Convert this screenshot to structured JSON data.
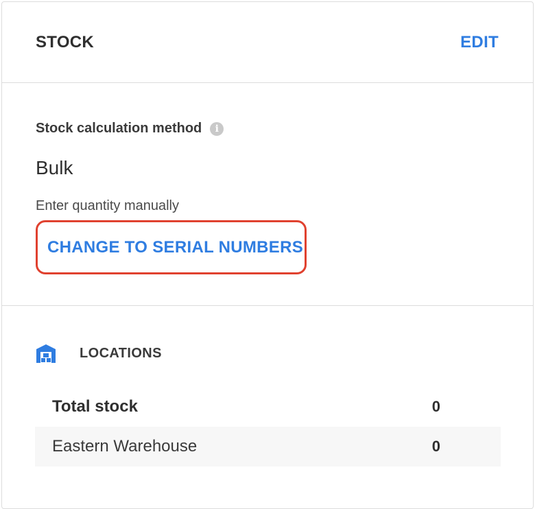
{
  "header": {
    "title": "STOCK",
    "edit_label": "EDIT"
  },
  "method": {
    "label": "Stock calculation method",
    "info_icon": "info-icon",
    "value": "Bulk",
    "description": "Enter quantity manually",
    "change_label": "CHANGE TO SERIAL NUMBERS"
  },
  "locations": {
    "icon": "warehouse-icon",
    "title": "LOCATIONS",
    "rows": [
      {
        "label": "Total stock",
        "value": "0"
      },
      {
        "label": "Eastern Warehouse",
        "value": "0"
      }
    ]
  },
  "colors": {
    "accent": "#2f7de1",
    "highlight_border": "#e0412f"
  }
}
